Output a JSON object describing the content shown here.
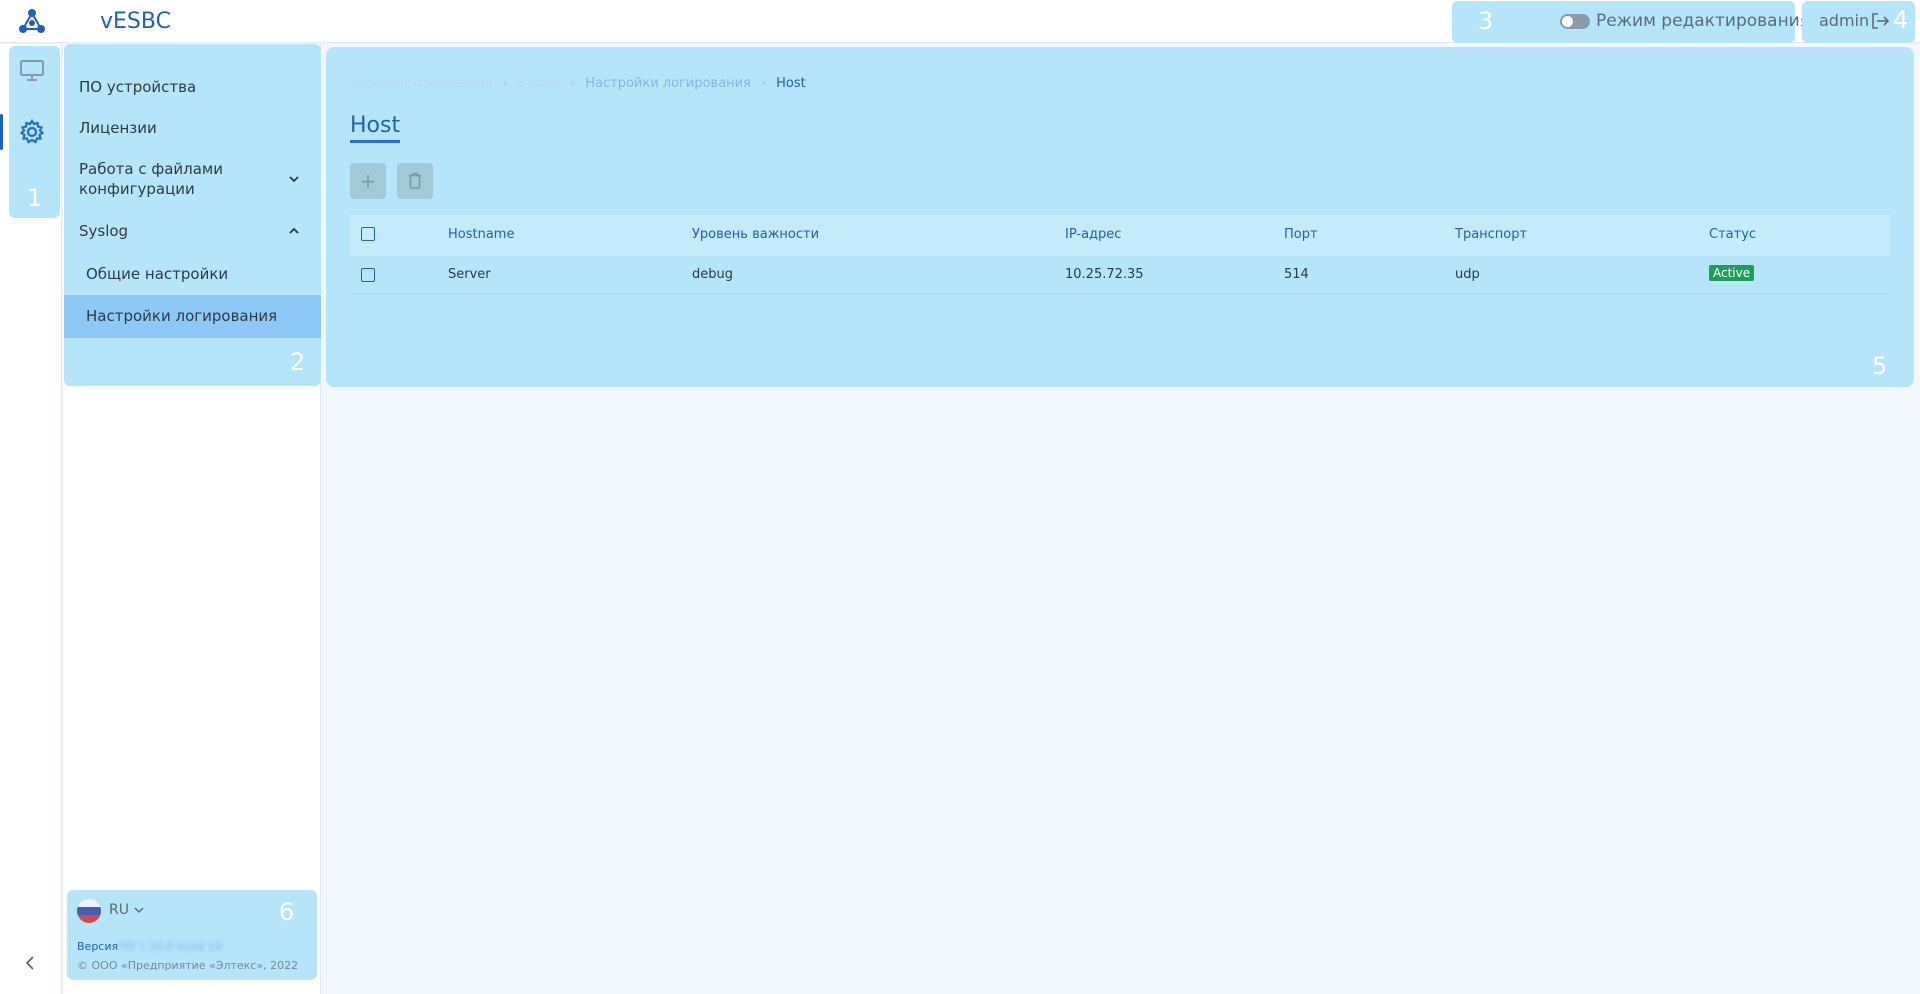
{
  "header": {
    "app_title": "vESBC",
    "edit_mode_label": "Режим редактирования",
    "user": "admin",
    "edit_mode_on": false
  },
  "overlay_numbers": [
    "1",
    "2",
    "3",
    "4",
    "5",
    "6"
  ],
  "rail": {
    "items": [
      {
        "icon": "monitor-icon",
        "active": false
      },
      {
        "icon": "gear-icon",
        "active": true
      }
    ]
  },
  "sidenav": {
    "items": [
      {
        "label": "ПО устройства"
      },
      {
        "label": "Лицензии"
      },
      {
        "label_line1": "Работа с файлами",
        "label_line2": "конфигурации",
        "expanded": false
      },
      {
        "label": "Syslog",
        "expanded": true
      }
    ],
    "subitems": [
      {
        "label": "Общие настройки",
        "selected": false
      },
      {
        "label": "Настройки логирования",
        "selected": true
      }
    ],
    "footer": {
      "language": "RU",
      "version_label": "Версия",
      "version_value": "ПО 1.20.0 build 19",
      "copyright": "© ООО «Предприятие «Элтекс», 2022"
    }
  },
  "main": {
    "breadcrumb": [
      "Администрирование",
      "Syslog",
      "Настройки логирования",
      "Host"
    ],
    "title": "Host",
    "toolbar": {
      "add": "+",
      "delete_icon": "trash-icon"
    },
    "table": {
      "columns": [
        "Hostname",
        "Уровень важности",
        "IP-адрес",
        "Порт",
        "Транспорт",
        "Статус"
      ],
      "rows": [
        {
          "hostname": "Server",
          "level": "debug",
          "ip": "10.25.72.35",
          "port": "514",
          "transport": "udp",
          "status": "Active"
        }
      ]
    }
  },
  "colors": {
    "accent": "#1f5fbf",
    "highlight": "#b6e4f9",
    "status_active": "#1e9e5a"
  }
}
